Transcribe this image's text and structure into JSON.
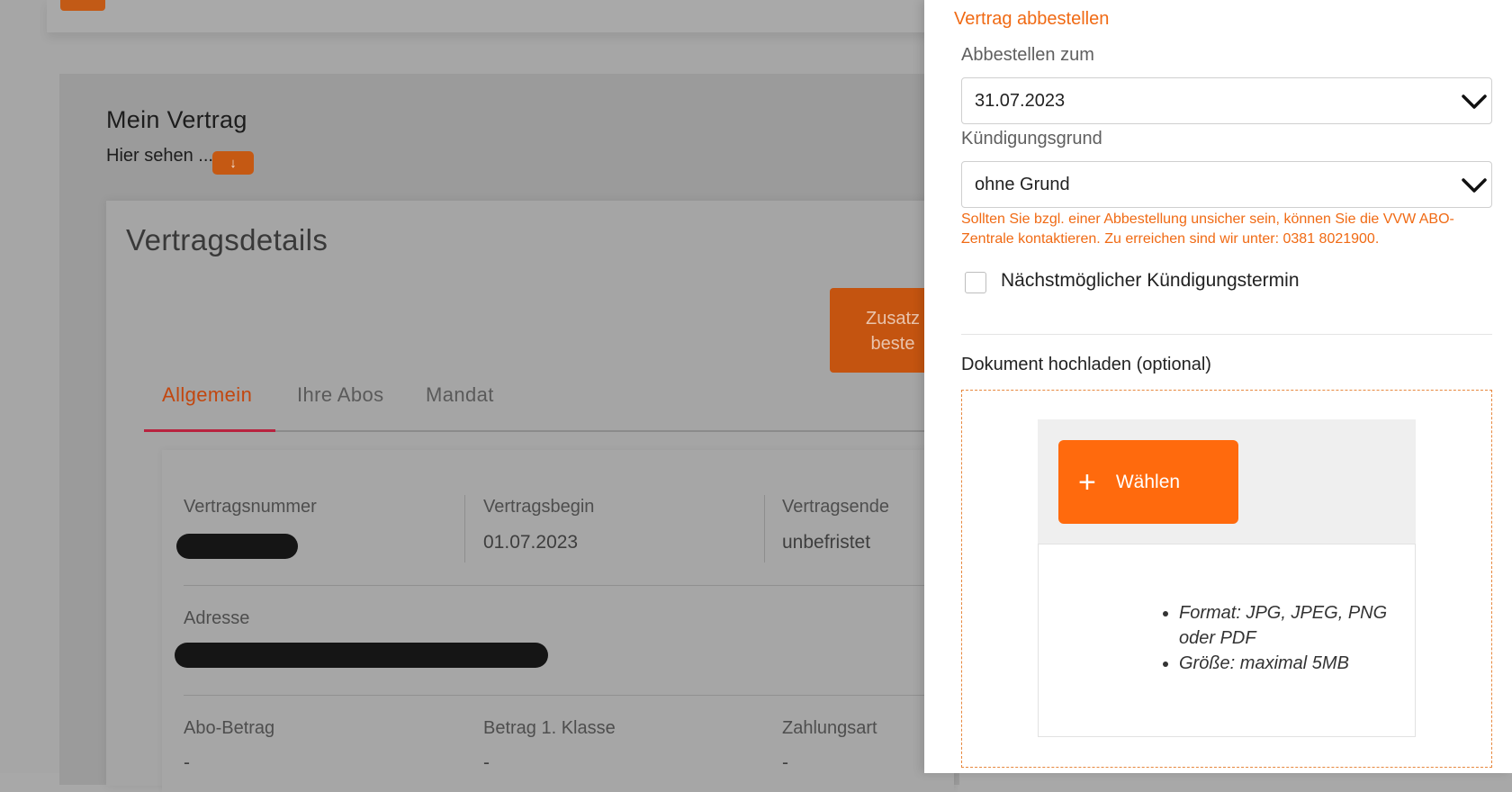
{
  "background": {
    "heading": "Mein Vertrag",
    "subheading": "Hier sehen ...",
    "down_badge": "↓",
    "card_title": "Vertragsdetails",
    "extra_button_line1": "Zusatz",
    "extra_button_line2": "beste",
    "tabs": [
      "Allgemein",
      "Ihre Abos",
      "Mandat"
    ],
    "rows": [
      [
        {
          "label": "Vertragsnummer",
          "value": ""
        },
        {
          "label": "Vertragsbegin",
          "value": "01.07.2023"
        },
        {
          "label": "Vertragsende",
          "value": "unbefristet"
        }
      ],
      [
        {
          "label": "Adresse",
          "value": ""
        }
      ],
      [
        {
          "label": "Abo-Betrag",
          "value": "-"
        },
        {
          "label": "Betrag 1. Klasse",
          "value": "-"
        },
        {
          "label": "Zahlungsart",
          "value": "-"
        }
      ]
    ]
  },
  "panel": {
    "title": "Vertrag abbestellen",
    "date_label": "Abbestellen zum",
    "date_value": "31.07.2023",
    "reason_label": "Kündigungsgrund",
    "reason_value": "ohne Grund",
    "hint": "Sollten Sie bzgl. einer Abbestellung unsicher sein, können Sie die VVW ABO-Zentrale kontaktieren. Zu erreichen sind wir unter: 0381 8021900.",
    "checkbox_label": "Nächstmöglicher Kündigungstermin",
    "checkbox_checked": false,
    "upload_label": "Dokument hochladen (optional)",
    "choose_button": "Wählen",
    "choose_icon": "plus-icon",
    "requirements": [
      "Format: JPG, JPEG, PNG oder PDF",
      "Größe: maximal 5MB"
    ]
  },
  "colors": {
    "accent": "#f06a14",
    "button": "#ff6a0d",
    "tab_active_underline": "#b8233f",
    "overlay_bg": "#a6a6a6"
  }
}
